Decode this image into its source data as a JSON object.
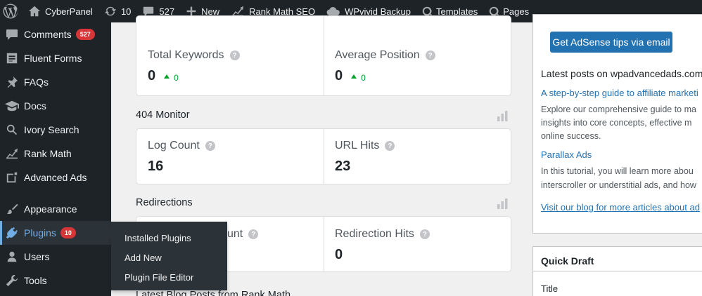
{
  "adminbar": {
    "site_name": "CyberPanel",
    "updates_count": "10",
    "comments_count": "527",
    "new_label": "New",
    "rank_math_label": "Rank Math SEO",
    "wpvivid_label": "WPvivid Backup",
    "templates_label": "Templates",
    "pages_label": "Pages"
  },
  "sidebar": {
    "comments": "Comments",
    "comments_badge": "527",
    "fluent_forms": "Fluent Forms",
    "faqs": "FAQs",
    "docs": "Docs",
    "ivory_search": "Ivory Search",
    "rank_math": "Rank Math",
    "advanced_ads": "Advanced Ads",
    "appearance": "Appearance",
    "plugins": "Plugins",
    "plugins_badge": "10",
    "users": "Users",
    "tools": "Tools",
    "accent_color": "#72aee6"
  },
  "flyout": {
    "installed_plugins": "Installed Plugins",
    "add_new": "Add New",
    "plugin_file_editor": "Plugin File Editor"
  },
  "keywords": {
    "total_keywords_label": "Total Keywords",
    "total_keywords_value": "0",
    "total_keywords_delta": "0",
    "average_position_label": "Average Position",
    "average_position_value": "0",
    "average_position_delta": "0"
  },
  "monitor_404": {
    "title": "404 Monitor",
    "log_count_label": "Log Count",
    "log_count_value": "16",
    "url_hits_label": "URL Hits",
    "url_hits_value": "23"
  },
  "redirections": {
    "title": "Redirections",
    "redirection_count_label": "unt",
    "redirection_hits_label": "Redirection Hits",
    "redirection_hits_value": "0"
  },
  "blog_posts": {
    "title": "Latest Blog Posts from Rank Math"
  },
  "adsense": {
    "button_label": "Get AdSense tips via email",
    "latest_posts_heading": "Latest posts on wpadvancedads.com",
    "post1_title": "A step-by-step guide to affiliate marketi",
    "post1_line1": "Explore our comprehensive guide to ma",
    "post1_line2": "insights into core concepts, effective m",
    "post1_line3": "online success.",
    "post2_title": "Parallax Ads",
    "post2_line1": "In this tutorial, you will learn more abou",
    "post2_line2": "interscroller or understitial ads, and how",
    "blog_link": "Visit our blog for more articles about ad"
  },
  "quick_draft": {
    "title": "Quick Draft",
    "title_label": "Title"
  }
}
